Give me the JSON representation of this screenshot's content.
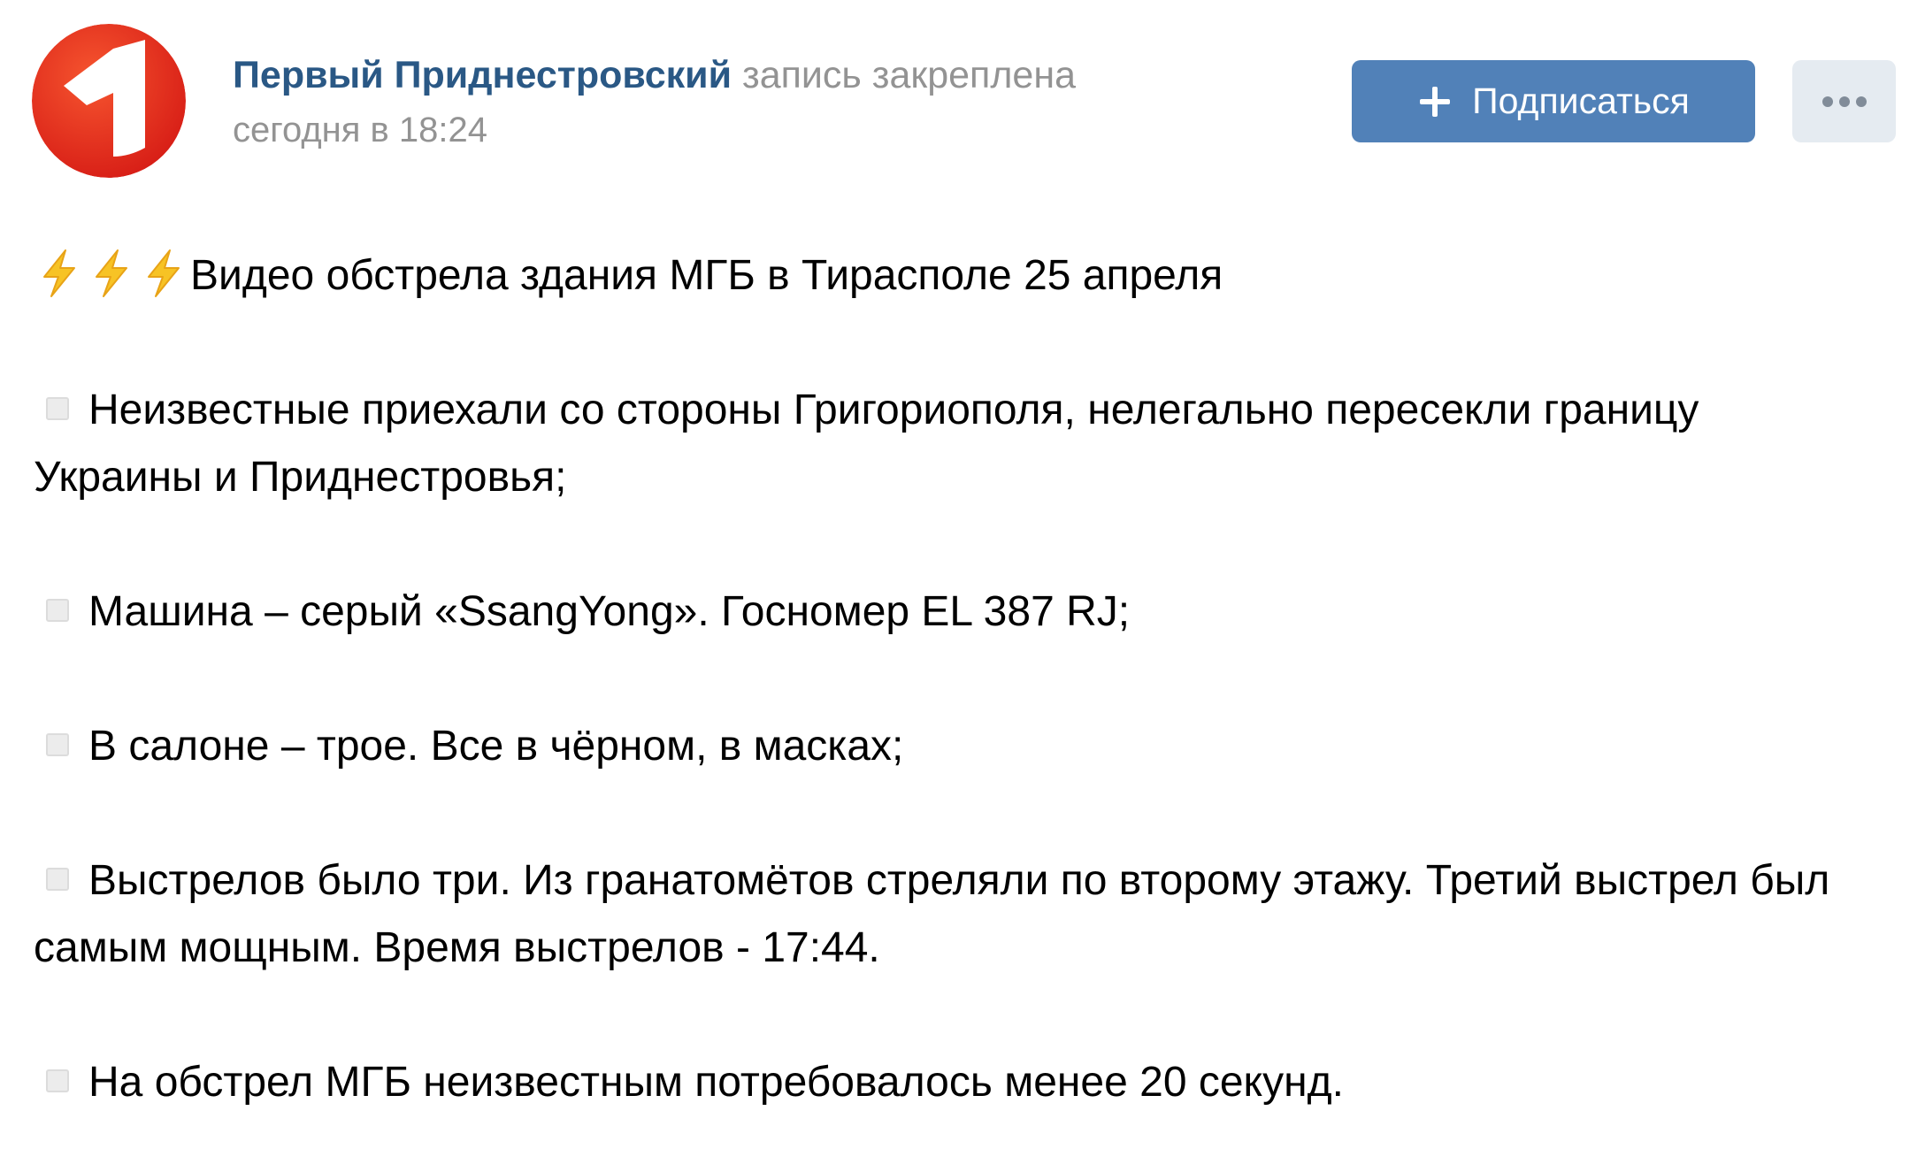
{
  "post": {
    "author_name": "Первый Приднестровский",
    "pinned_label": "запись закреплена",
    "date": "сегодня в 18:24",
    "subscribe_label": "Подписаться",
    "headline": "Видео обстрела здания МГБ в Тирасполе 25 апреля",
    "paragraphs": [
      "Неизвестные приехали со стороны Григориополя, нелегально пересекли границу Украины и Приднестровья;",
      "Машина – серый «SsangYong». Госномер EL 387 RJ;",
      "В салоне – трое. Все в чёрном, в масках;",
      "Выстрелов было три. Из гранатомётов стреляли по второму этажу. Третий выстрел был самым мощным. Время выстрелов - 17:44.",
      "На обстрел МГБ неизвестным потребовалось менее 20 секунд."
    ]
  },
  "icons": {
    "avatar": "channel-logo-1",
    "headline_emoji": "lightning-icon",
    "bullet_emoji": "square-bullet-icon",
    "subscribe_icon": "plus-icon",
    "more_icon": "ellipsis-icon"
  },
  "colors": {
    "link": "#2a5885",
    "meta": "#939393",
    "primary_button": "#5181b8",
    "secondary_button": "#e5ebf1",
    "logo_red": "#e2231a",
    "lightning": "#f7c325"
  }
}
